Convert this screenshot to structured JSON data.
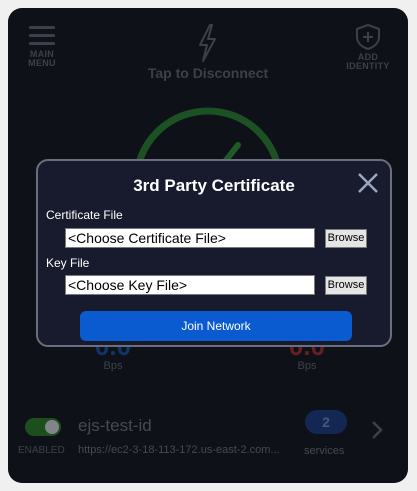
{
  "header": {
    "main_menu_line1": "MAIN",
    "main_menu_line2": "MENU",
    "tap_text": "Tap to Disconnect",
    "add_identity_line1": "ADD",
    "add_identity_line2": "IDENTITY"
  },
  "speeds": {
    "download": {
      "value": "0.0",
      "unit": "Bps",
      "color": "#1d4f9e"
    },
    "upload": {
      "value": "0.0",
      "unit": "Bps",
      "color": "#9e2f2f"
    }
  },
  "identity": {
    "enabled": true,
    "enabled_label": "ENABLED",
    "name": "ejs-test-id",
    "url": "https://ec2-3-18-113-172.us-east-2.com...",
    "services_count": "2",
    "services_label": "services"
  },
  "modal": {
    "title": "3rd Party Certificate",
    "certificate_label": "Certificate File",
    "certificate_value": "<Choose Certificate File>",
    "key_label": "Key File",
    "key_value": "<Choose Key File>",
    "browse_label": "Browse",
    "join_label": "Join Network"
  },
  "colors": {
    "app_bg": "#181b26",
    "accent": "#0a5bd0",
    "gauge_green": "#2f8a3a"
  }
}
